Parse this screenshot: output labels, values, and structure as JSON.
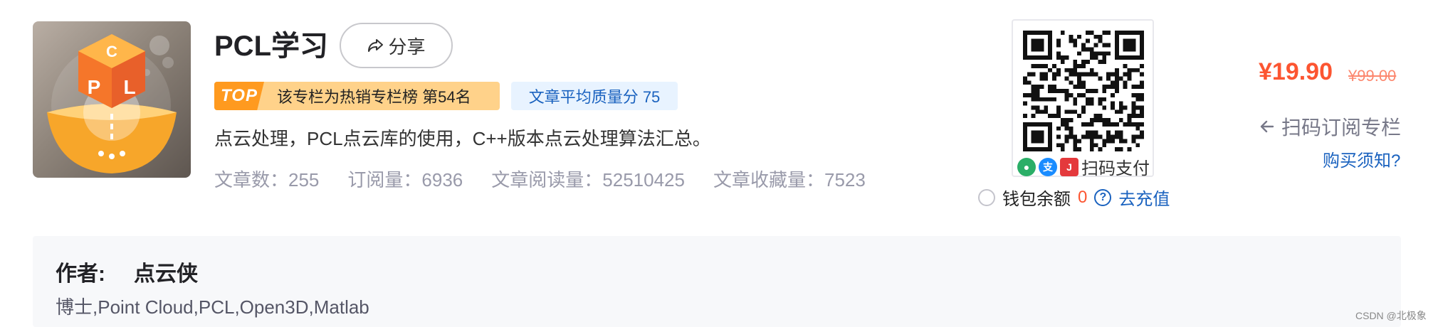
{
  "column": {
    "title": "PCL学习",
    "share_label": "分享",
    "top_badge_tag": "TOP",
    "top_badge_text": "该专栏为热销专栏榜 第54名",
    "quality_badge": "文章平均质量分 75",
    "description": "点云处理，PCL点云库的使用，C++版本点云处理算法汇总。",
    "stats": [
      {
        "label": "文章数：",
        "value": "255"
      },
      {
        "label": "订阅量：",
        "value": "6936"
      },
      {
        "label": "文章阅读量：",
        "value": "52510425"
      },
      {
        "label": "文章收藏量：",
        "value": "7523"
      }
    ],
    "cover_letters": [
      "C",
      "P",
      "L"
    ]
  },
  "payment": {
    "qr_caption": "扫码支付",
    "pay_methods": [
      "wechat-pay-icon",
      "alipay-icon",
      "jd-pay-icon"
    ],
    "wallet_label": "钱包余额",
    "wallet_value": "0",
    "recharge_label": "去充值",
    "price": "¥19.90",
    "original_price": "¥99.00",
    "scan_subscribe": "扫码订阅专栏",
    "buy_notice": "购买须知?"
  },
  "author": {
    "label": "作者:",
    "name": "点云侠",
    "bio": "博士,Point Cloud,PCL,Open3D,Matlab"
  },
  "watermark": "CSDN @北极象",
  "colors": {
    "accent_red": "#fc5531",
    "link_blue": "#1a62bf",
    "top_badge_bg": "#ffd28a",
    "quality_badge_bg": "#e8f3ff"
  }
}
